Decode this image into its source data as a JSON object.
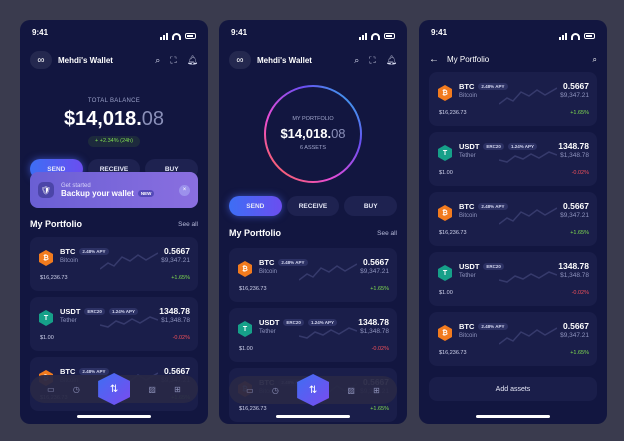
{
  "status": {
    "time": "9:41"
  },
  "wallet": {
    "title": "Mehdi's Wallet",
    "total_label": "TOTAL BALANCE",
    "balance_main": "$14,018.",
    "balance_dec": "08",
    "change": "+ +2.34% (24h)"
  },
  "actions": {
    "send": "SEND",
    "receive": "RECEIVE",
    "buy": "BUY"
  },
  "backup": {
    "small": "Get started",
    "big": "Backup your wallet",
    "badge": "NEW",
    "close": "×"
  },
  "portfolio": {
    "title": "My Portfolio",
    "see_all": "See all",
    "ring_label": "MY PORTFOLIO",
    "ring_assets": "6 ASSETS",
    "progress_fraction": 1.0
  },
  "assets": [
    {
      "symbol": "BTC",
      "tag": "2.48% APY",
      "tag2": "",
      "name": "Bitcoin",
      "amount": "0.5667",
      "fiat": "$9,347.21",
      "price": "$16,236.73",
      "change": "+1.65%",
      "dir": "up"
    },
    {
      "symbol": "USDT",
      "tag": "ERC20",
      "tag2": "1.24% APY",
      "name": "Tether",
      "amount": "1348.78",
      "fiat": "$1,348.78",
      "price": "$1.00",
      "change": "-0.02%",
      "dir": "down"
    },
    {
      "symbol": "BTC",
      "tag": "2.48% APY",
      "tag2": "",
      "name": "Bitcoin",
      "amount": "0.5667",
      "fiat": "$9,347.21",
      "price": "$16,236.73",
      "change": "+1.65%",
      "dir": "up"
    }
  ],
  "list_assets": [
    {
      "symbol": "BTC",
      "tag": "2.48% APY",
      "tag2": "",
      "name": "Bitcoin",
      "amount": "0.5667",
      "fiat": "$9,347.21",
      "price": "$16,236.73",
      "change": "+1.65%",
      "dir": "up"
    },
    {
      "symbol": "USDT",
      "tag": "ERC20",
      "tag2": "1.24% APY",
      "name": "Tether",
      "amount": "1348.78",
      "fiat": "$1,348.78",
      "price": "$1.00",
      "change": "-0.02%",
      "dir": "down"
    },
    {
      "symbol": "BTC",
      "tag": "2.48% APY",
      "tag2": "",
      "name": "Bitcoin",
      "amount": "0.5667",
      "fiat": "$9,347.21",
      "price": "$16,236.73",
      "change": "+1.65%",
      "dir": "up"
    },
    {
      "symbol": "USDT",
      "tag": "ERC20",
      "tag2": "",
      "name": "Tether",
      "amount": "1348.78",
      "fiat": "$1,348.78",
      "price": "$1.00",
      "change": "-0.02%",
      "dir": "down"
    },
    {
      "symbol": "BTC",
      "tag": "2.48% APY",
      "tag2": "",
      "name": "Bitcoin",
      "amount": "0.5667",
      "fiat": "$9,347.21",
      "price": "$16,236.73",
      "change": "+1.65%",
      "dir": "up"
    }
  ],
  "add_assets": "Add assets",
  "colors": {
    "background": "#3a3b4e",
    "panel": "#121640",
    "accent": "#3d6ef5",
    "btc": "#f27b1e",
    "usdt": "#16a089",
    "up": "#7fdd4f",
    "down": "#f0505a"
  },
  "icons": [
    "search-icon",
    "scan-icon",
    "bell-icon",
    "wallet-icon",
    "clock-icon",
    "swap-icon",
    "chart-icon",
    "grid-icon",
    "back-arrow-icon",
    "shield-icon"
  ]
}
